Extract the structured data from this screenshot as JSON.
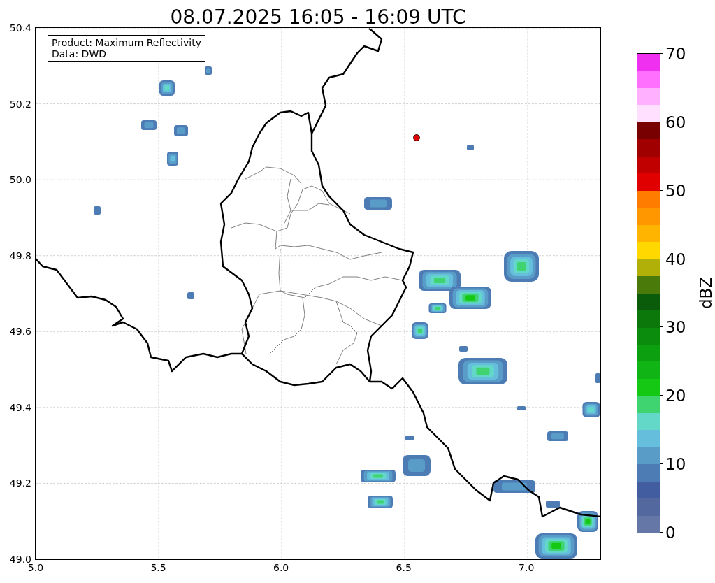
{
  "title": "08.07.2025 16:05 - 16:09 UTC",
  "info_box": [
    "Product: Maximum Reflectivity",
    "Data: DWD"
  ],
  "map": {
    "x_ticks": [
      "5.0",
      "5.5",
      "6.0",
      "6.5",
      "7.0"
    ],
    "y_ticks": [
      "50.4",
      "50.2",
      "50.0",
      "49.8",
      "49.6",
      "49.4",
      "49.2",
      "49.0"
    ]
  },
  "colorbar": {
    "label": "dBZ",
    "ticks": [
      "70",
      "60",
      "50",
      "40",
      "30",
      "20",
      "10",
      "0"
    ],
    "segments": [
      {
        "color": "#f030f0"
      },
      {
        "color": "#ff70ff"
      },
      {
        "color": "#ffb0ff"
      },
      {
        "color": "#ffe0ff"
      },
      {
        "color": "#780000"
      },
      {
        "color": "#a00000"
      },
      {
        "color": "#c00000"
      },
      {
        "color": "#e00000"
      },
      {
        "color": "#ff7c00"
      },
      {
        "color": "#ff9800"
      },
      {
        "color": "#ffb400"
      },
      {
        "color": "#ffd800"
      },
      {
        "color": "#b0b008"
      },
      {
        "color": "#4a7a0a"
      },
      {
        "color": "#0a5c0a"
      },
      {
        "color": "#0c780c"
      },
      {
        "color": "#0c8c0c"
      },
      {
        "color": "#0ca010"
      },
      {
        "color": "#10b414"
      },
      {
        "color": "#14c814"
      },
      {
        "color": "#40d470"
      },
      {
        "color": "#64d8c8"
      },
      {
        "color": "#64bedc"
      },
      {
        "color": "#5a9cc8"
      },
      {
        "color": "#4d7cb4"
      },
      {
        "color": "#425ea0"
      },
      {
        "color": "#5468a0"
      },
      {
        "color": "#6477a6"
      }
    ]
  }
}
